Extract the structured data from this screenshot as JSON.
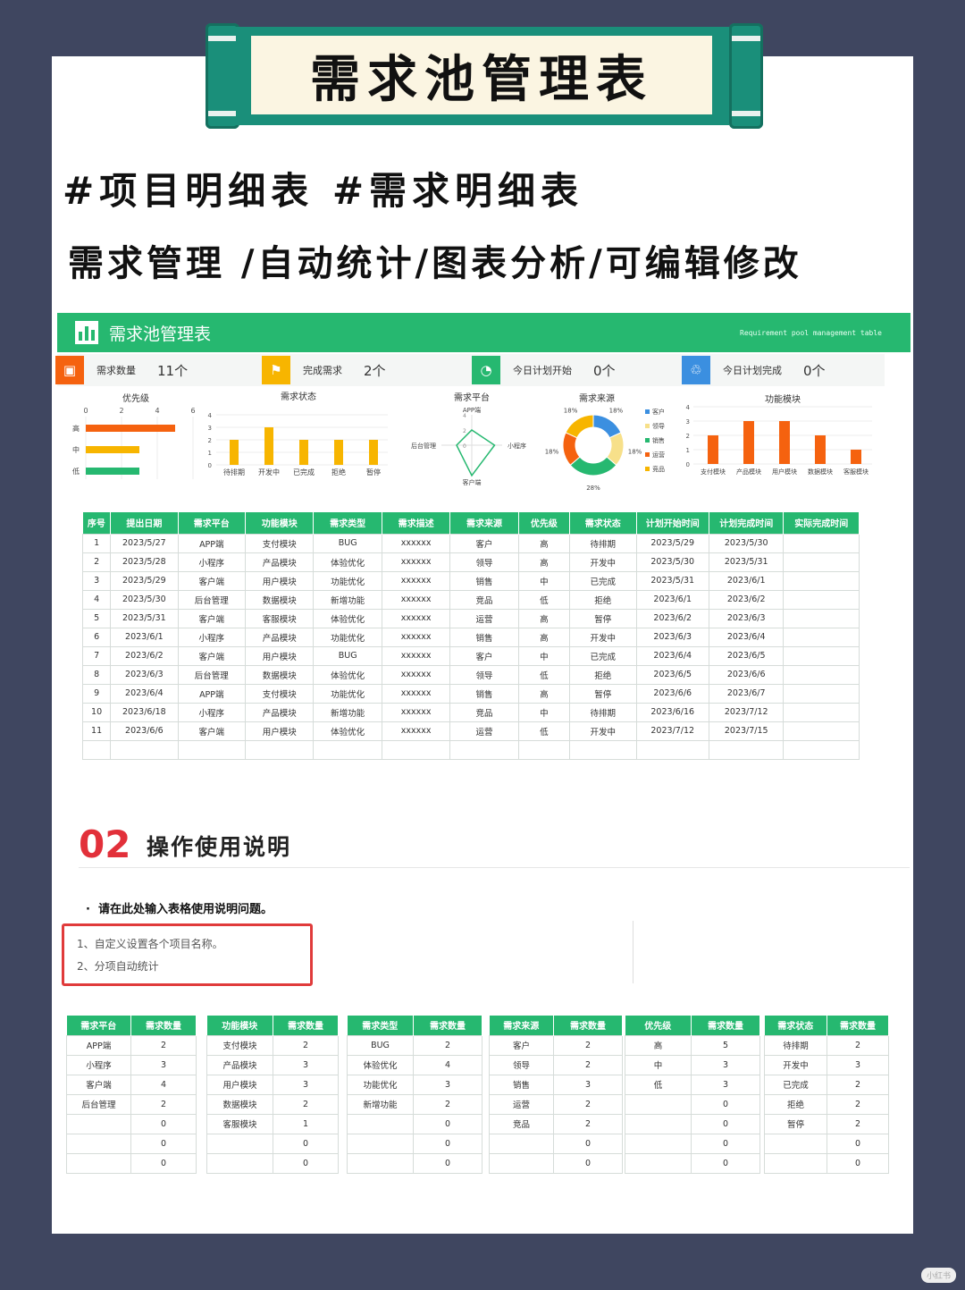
{
  "banner": {
    "title": "需求池管理表"
  },
  "taglines": {
    "line1": "#项目明细表 #需求明细表",
    "line2": "需求管理 /自动统计/图表分析/可编辑修改"
  },
  "dashboard": {
    "title": "需求池管理表",
    "subtitle": "Requirement pool management table",
    "kpis": [
      {
        "label": "需求数量",
        "value": "11个",
        "color": "#f5620f",
        "icon": "presentation-icon"
      },
      {
        "label": "完成需求",
        "value": "2个",
        "color": "#f7b500",
        "icon": "flag-icon"
      },
      {
        "label": "今日计划开始",
        "value": "0个",
        "color": "#26b870",
        "icon": "pie-icon"
      },
      {
        "label": "今日计划完成",
        "value": "0个",
        "color": "#3b8fe0",
        "icon": "cycle-icon"
      }
    ]
  },
  "chart_data": [
    {
      "type": "bar",
      "title": "优先级",
      "orientation": "horizontal",
      "categories": [
        "高",
        "中",
        "低"
      ],
      "values": [
        5,
        3,
        3
      ],
      "colors": [
        "#f5620f",
        "#f7b500",
        "#26b870"
      ],
      "xlim": [
        0,
        6
      ],
      "ticks": [
        "0",
        "2",
        "4",
        "6"
      ]
    },
    {
      "type": "bar",
      "title": "需求状态",
      "categories": [
        "待排期",
        "开发中",
        "已完成",
        "拒绝",
        "暂停"
      ],
      "values": [
        2,
        3,
        2,
        2,
        2
      ],
      "color": "#f7b500",
      "ylim": [
        0,
        4
      ],
      "ticks": [
        "0",
        "1",
        "2",
        "3",
        "4"
      ]
    },
    {
      "type": "radar",
      "title": "需求平台",
      "categories": [
        "APP端",
        "小程序",
        "客户端",
        "后台管理"
      ],
      "values": [
        2,
        3,
        4,
        2
      ],
      "ticks": [
        "0",
        "2",
        "4"
      ]
    },
    {
      "type": "pie",
      "title": "需求来源",
      "categories": [
        "客户",
        "领导",
        "销售",
        "运营",
        "竞品"
      ],
      "values": [
        2,
        2,
        3,
        2,
        2
      ],
      "labels": [
        "18%",
        "18%",
        "28%",
        "18%",
        "18%"
      ],
      "colors": [
        "#3b8fe0",
        "#f7e08a",
        "#26b870",
        "#f5620f",
        "#f7b500"
      ]
    },
    {
      "type": "bar",
      "title": "功能模块",
      "categories": [
        "支付模块",
        "产品模块",
        "用户模块",
        "数据模块",
        "客服模块"
      ],
      "values": [
        2,
        3,
        3,
        2,
        1
      ],
      "color": "#f5620f",
      "ylim": [
        0,
        4
      ],
      "ticks": [
        "0",
        "1",
        "2",
        "3",
        "4"
      ]
    }
  ],
  "table": {
    "headers": [
      "序号",
      "提出日期",
      "需求平台",
      "功能模块",
      "需求类型",
      "需求描述",
      "需求来源",
      "优先级",
      "需求状态",
      "计划开始时间",
      "计划完成时间",
      "实际完成时间"
    ],
    "rows": [
      [
        "1",
        "2023/5/27",
        "APP端",
        "支付模块",
        "BUG",
        "xxxxxx",
        "客户",
        "高",
        "待排期",
        "2023/5/29",
        "2023/5/30",
        ""
      ],
      [
        "2",
        "2023/5/28",
        "小程序",
        "产品模块",
        "体验优化",
        "xxxxxx",
        "领导",
        "高",
        "开发中",
        "2023/5/30",
        "2023/5/31",
        ""
      ],
      [
        "3",
        "2023/5/29",
        "客户端",
        "用户模块",
        "功能优化",
        "xxxxxx",
        "销售",
        "中",
        "已完成",
        "2023/5/31",
        "2023/6/1",
        ""
      ],
      [
        "4",
        "2023/5/30",
        "后台管理",
        "数据模块",
        "新增功能",
        "xxxxxx",
        "竞品",
        "低",
        "拒绝",
        "2023/6/1",
        "2023/6/2",
        ""
      ],
      [
        "5",
        "2023/5/31",
        "客户端",
        "客服模块",
        "体验优化",
        "xxxxxx",
        "运营",
        "高",
        "暂停",
        "2023/6/2",
        "2023/6/3",
        ""
      ],
      [
        "6",
        "2023/6/1",
        "小程序",
        "产品模块",
        "功能优化",
        "xxxxxx",
        "销售",
        "高",
        "开发中",
        "2023/6/3",
        "2023/6/4",
        ""
      ],
      [
        "7",
        "2023/6/2",
        "客户端",
        "用户模块",
        "BUG",
        "xxxxxx",
        "客户",
        "中",
        "已完成",
        "2023/6/4",
        "2023/6/5",
        ""
      ],
      [
        "8",
        "2023/6/3",
        "后台管理",
        "数据模块",
        "体验优化",
        "xxxxxx",
        "领导",
        "低",
        "拒绝",
        "2023/6/5",
        "2023/6/6",
        ""
      ],
      [
        "9",
        "2023/6/4",
        "APP端",
        "支付模块",
        "功能优化",
        "xxxxxx",
        "销售",
        "高",
        "暂停",
        "2023/6/6",
        "2023/6/7",
        ""
      ],
      [
        "10",
        "2023/6/18",
        "小程序",
        "产品模块",
        "新增功能",
        "xxxxxx",
        "竞品",
        "中",
        "待排期",
        "2023/6/16",
        "2023/7/12",
        ""
      ],
      [
        "11",
        "2023/6/6",
        "客户端",
        "用户模块",
        "体验优化",
        "xxxxxx",
        "运营",
        "低",
        "开发中",
        "2023/7/12",
        "2023/7/15",
        ""
      ],
      [
        "",
        "",
        "",
        "",
        "",
        "",
        "",
        "",
        "",
        "",
        "",
        ""
      ]
    ]
  },
  "section": {
    "number": "02",
    "title": "操作使用说明",
    "bullet": "请在此处输入表格使用说明问题。",
    "notes": [
      "1、自定义设置各个项目名称。",
      "2、分项自动统计"
    ]
  },
  "stats": [
    {
      "h1": "需求平台",
      "h2": "需求数量",
      "rows": [
        [
          "APP端",
          "2"
        ],
        [
          "小程序",
          "3"
        ],
        [
          "客户端",
          "4"
        ],
        [
          "后台管理",
          "2"
        ],
        [
          "",
          "0"
        ],
        [
          "",
          "0"
        ],
        [
          "",
          "0"
        ]
      ]
    },
    {
      "h1": "功能模块",
      "h2": "需求数量",
      "rows": [
        [
          "支付模块",
          "2"
        ],
        [
          "产品模块",
          "3"
        ],
        [
          "用户模块",
          "3"
        ],
        [
          "数据模块",
          "2"
        ],
        [
          "客服模块",
          "1"
        ],
        [
          "",
          "0"
        ],
        [
          "",
          "0"
        ]
      ]
    },
    {
      "h1": "需求类型",
      "h2": "需求数量",
      "rows": [
        [
          "BUG",
          "2"
        ],
        [
          "体验优化",
          "4"
        ],
        [
          "功能优化",
          "3"
        ],
        [
          "新增功能",
          "2"
        ],
        [
          "",
          "0"
        ],
        [
          "",
          "0"
        ],
        [
          "",
          "0"
        ]
      ]
    },
    {
      "h1": "需求来源",
      "h2": "需求数量",
      "rows": [
        [
          "客户",
          "2"
        ],
        [
          "领导",
          "2"
        ],
        [
          "销售",
          "3"
        ],
        [
          "运营",
          "2"
        ],
        [
          "竞品",
          "2"
        ],
        [
          "",
          "0"
        ],
        [
          "",
          "0"
        ]
      ]
    },
    {
      "h1": "优先级",
      "h2": "需求数量",
      "rows": [
        [
          "高",
          "5"
        ],
        [
          "中",
          "3"
        ],
        [
          "低",
          "3"
        ],
        [
          "",
          "0"
        ],
        [
          "",
          "0"
        ],
        [
          "",
          "0"
        ],
        [
          "",
          "0"
        ]
      ]
    },
    {
      "h1": "需求状态",
      "h2": "需求数量",
      "rows": [
        [
          "待排期",
          "2"
        ],
        [
          "开发中",
          "3"
        ],
        [
          "已完成",
          "2"
        ],
        [
          "拒绝",
          "2"
        ],
        [
          "暂停",
          "2"
        ],
        [
          "",
          "0"
        ],
        [
          "",
          "0"
        ]
      ]
    }
  ],
  "watermark": "小红书"
}
